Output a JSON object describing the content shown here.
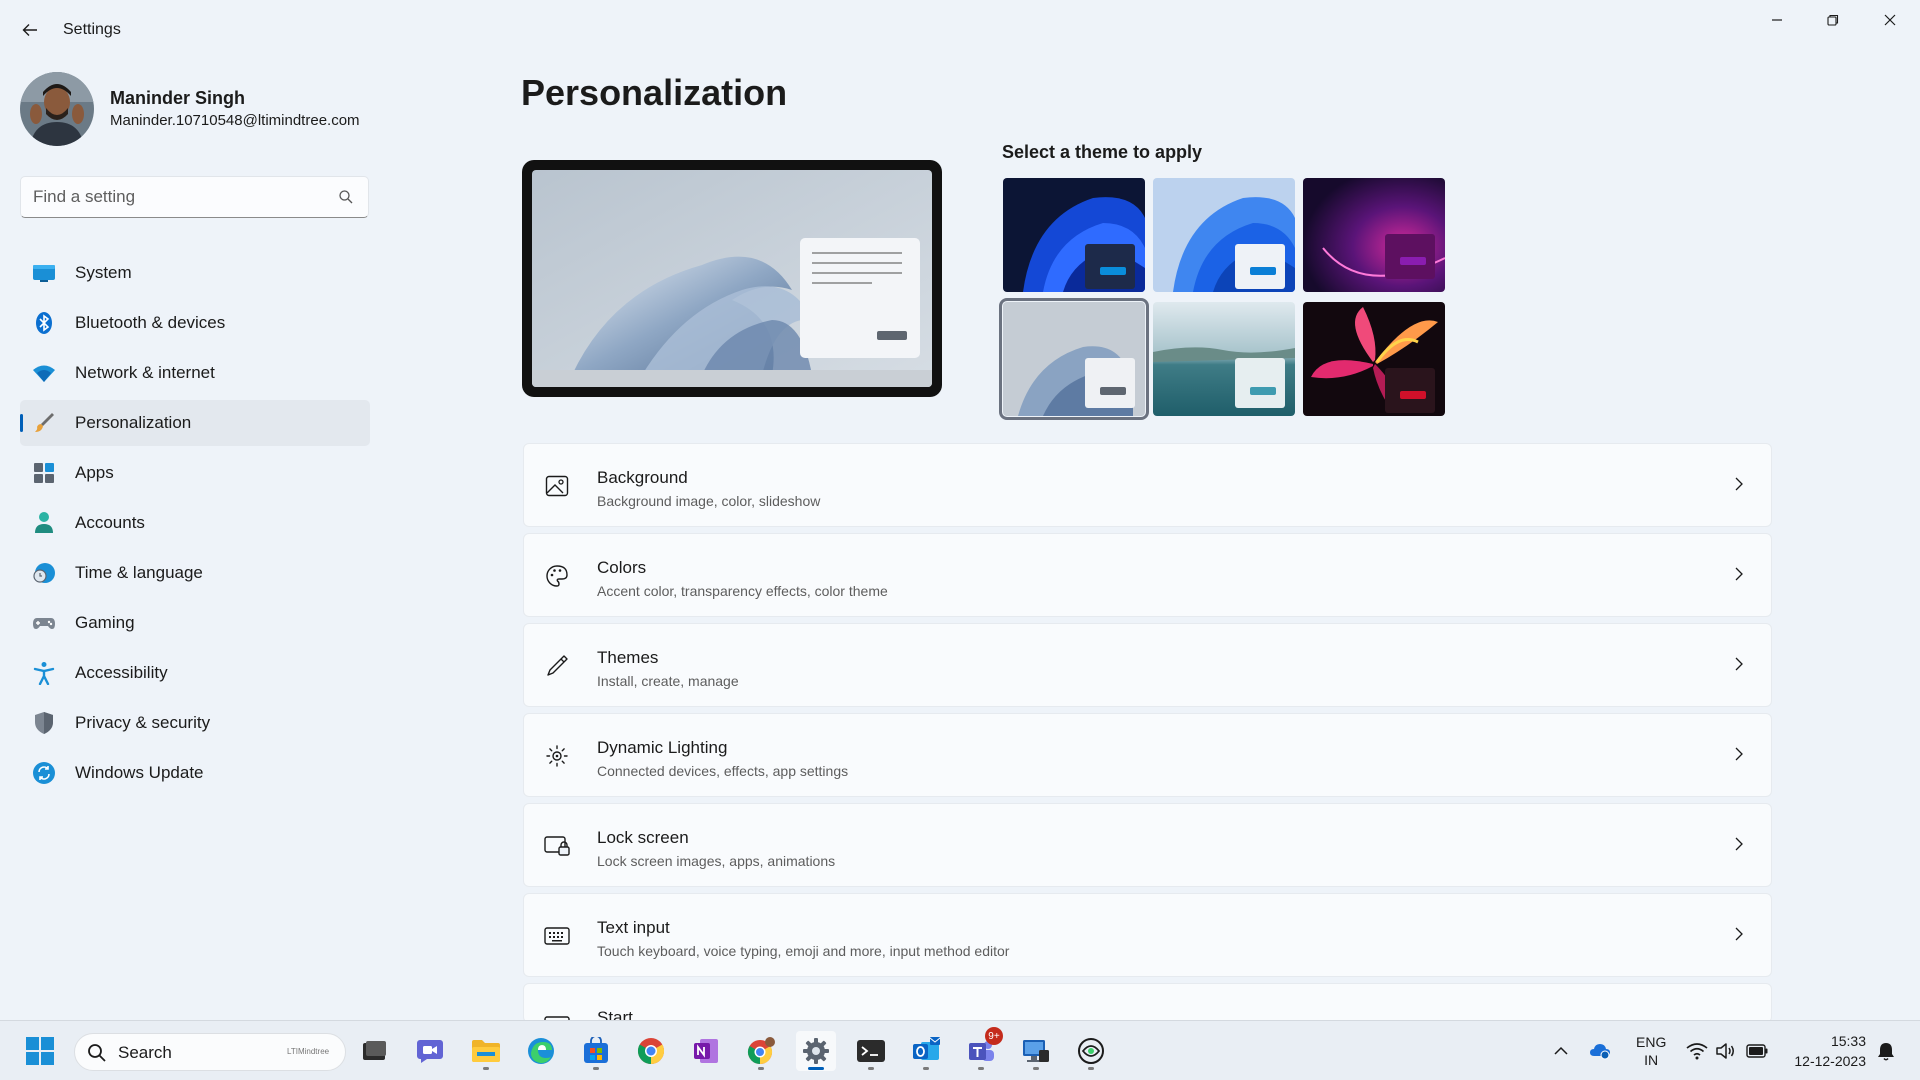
{
  "window": {
    "title": "Settings",
    "controls": [
      "minimize",
      "restore",
      "close"
    ]
  },
  "profile": {
    "name": "Maninder Singh",
    "email": "Maninder.10710548@ltimindtree.com"
  },
  "search": {
    "placeholder": "Find a setting"
  },
  "sidebar": {
    "items": [
      {
        "label": "System",
        "icon": "system-icon"
      },
      {
        "label": "Bluetooth & devices",
        "icon": "bluetooth-icon"
      },
      {
        "label": "Network & internet",
        "icon": "wifi-icon"
      },
      {
        "label": "Personalization",
        "icon": "brush-icon",
        "active": true
      },
      {
        "label": "Apps",
        "icon": "apps-icon"
      },
      {
        "label": "Accounts",
        "icon": "accounts-icon"
      },
      {
        "label": "Time & language",
        "icon": "clock-globe-icon"
      },
      {
        "label": "Gaming",
        "icon": "controller-icon"
      },
      {
        "label": "Accessibility",
        "icon": "accessibility-icon"
      },
      {
        "label": "Privacy & security",
        "icon": "shield-icon"
      },
      {
        "label": "Windows Update",
        "icon": "update-icon"
      }
    ]
  },
  "main": {
    "title": "Personalization",
    "theme_heading": "Select a theme to apply",
    "themes": [
      {
        "name": "windows-dark-bloom",
        "selected": false
      },
      {
        "name": "windows-light-bloom",
        "selected": false
      },
      {
        "name": "purple-glow",
        "selected": false
      },
      {
        "name": "light-bloom-current",
        "selected": true
      },
      {
        "name": "captured-motion",
        "selected": false
      },
      {
        "name": "flower",
        "selected": false
      }
    ],
    "settings": [
      {
        "title": "Background",
        "subtitle": "Background image, color, slideshow",
        "icon": "image-icon"
      },
      {
        "title": "Colors",
        "subtitle": "Accent color, transparency effects, color theme",
        "icon": "palette-icon"
      },
      {
        "title": "Themes",
        "subtitle": "Install, create, manage",
        "icon": "pen-icon"
      },
      {
        "title": "Dynamic Lighting",
        "subtitle": "Connected devices, effects, app settings",
        "icon": "sun-icon"
      },
      {
        "title": "Lock screen",
        "subtitle": "Lock screen images, apps, animations",
        "icon": "lock-screen-icon"
      },
      {
        "title": "Text input",
        "subtitle": "Touch keyboard, voice typing, emoji and more, input method editor",
        "icon": "keyboard-icon"
      },
      {
        "title": "Start",
        "subtitle": "",
        "icon": "start-icon"
      }
    ]
  },
  "taskbar": {
    "search_label": "Search",
    "search_brand": "LTIMindtree",
    "teams_badge": "9+",
    "lang_top": "ENG",
    "lang_bottom": "IN",
    "time": "15:33",
    "date": "12-12-2023",
    "colors": {
      "accent": "#005fb8",
      "badge": "#c42b1c"
    }
  }
}
